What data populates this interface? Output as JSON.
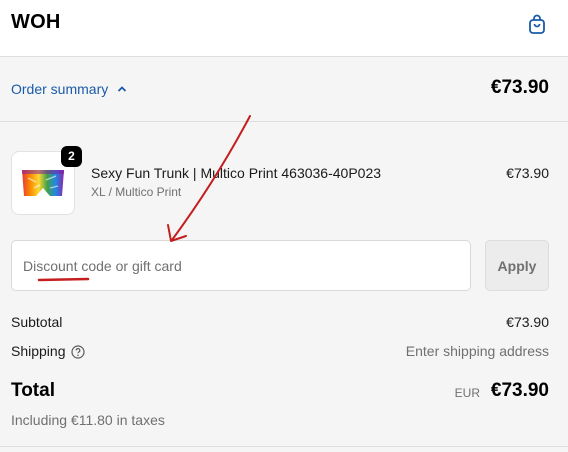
{
  "header": {
    "logo": "WOH",
    "cart_icon": "shopping-bag-icon"
  },
  "summary": {
    "toggle_label": "Order summary",
    "toggle_icon": "chevron-up-icon",
    "total": "€73.90"
  },
  "product": {
    "name": "Sexy Fun Trunk | Multico Print 463036-40P023",
    "variant": "XL / Multico Print",
    "price": "€73.90",
    "quantity": "2"
  },
  "discount": {
    "placeholder": "Discount code or gift card",
    "apply_label": "Apply"
  },
  "costs": {
    "subtotal_label": "Subtotal",
    "subtotal_value": "€73.90",
    "shipping_label": "Shipping",
    "shipping_value": "Enter shipping address",
    "shipping_help_icon": "question-circle-icon"
  },
  "total": {
    "label": "Total",
    "currency": "EUR",
    "value": "€73.90",
    "taxes_note": "Including €11.80 in taxes"
  },
  "colors": {
    "accent": "#1a5ba8",
    "annotation": "#c41e1e",
    "panel": "#f5f5f5"
  }
}
